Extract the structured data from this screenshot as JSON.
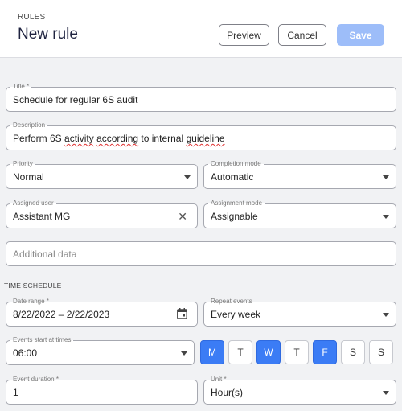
{
  "header": {
    "eyebrow": "RULES",
    "title": "New rule",
    "preview_label": "Preview",
    "cancel_label": "Cancel",
    "save_label": "Save"
  },
  "form": {
    "title": {
      "label": "Title *",
      "value": "Schedule for regular 6S audit"
    },
    "description": {
      "label": "Description",
      "value_parts": [
        "Perform 6S ",
        "activity",
        " ",
        "according",
        " to internal ",
        "guideline"
      ]
    },
    "priority": {
      "label": "Priority",
      "value": "Normal"
    },
    "completion_mode": {
      "label": "Completion mode",
      "value": "Automatic"
    },
    "assigned_user": {
      "label": "Assigned user",
      "value": "Assistant MG"
    },
    "assignment_mode": {
      "label": "Assignment mode",
      "value": "Assignable"
    },
    "additional_data": {
      "placeholder": "Additional data"
    }
  },
  "schedule": {
    "section_title": "TIME SCHEDULE",
    "date_range": {
      "label": "Date range *",
      "value": "8/22/2022 – 2/22/2023"
    },
    "repeat_events": {
      "label": "Repeat events",
      "value": "Every week"
    },
    "start_times": {
      "label": "Events start at times",
      "value": "06:00"
    },
    "days": [
      {
        "label": "M",
        "selected": true
      },
      {
        "label": "T",
        "selected": false
      },
      {
        "label": "W",
        "selected": true
      },
      {
        "label": "T",
        "selected": false
      },
      {
        "label": "F",
        "selected": true
      },
      {
        "label": "S",
        "selected": false
      },
      {
        "label": "S",
        "selected": false
      }
    ],
    "event_duration": {
      "label": "Event duration *",
      "value": "1"
    },
    "unit": {
      "label": "Unit *",
      "value": "Hour(s)"
    }
  },
  "colors": {
    "accent": "#3b7cf5",
    "save_disabled": "#9dbdf9"
  },
  "icons": {
    "clear": "close-icon",
    "calendar": "calendar-icon",
    "dropdown": "chevron-down-icon"
  }
}
